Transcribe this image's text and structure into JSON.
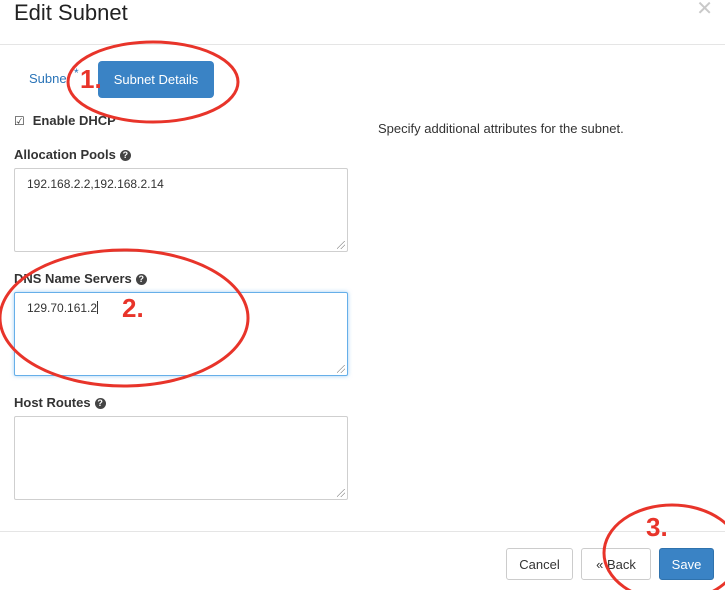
{
  "dialog": {
    "title": "Edit Subnet",
    "close_glyph": "✕"
  },
  "tabs": {
    "subnet_label": "Subne",
    "asterisk": "*",
    "details_label": "Subnet Details"
  },
  "form": {
    "enable_dhcp": {
      "label": "Enable DHCP",
      "checked": true,
      "check_glyph": "☑"
    },
    "help_text": "Specify additional attributes for the subnet.",
    "allocation_pools": {
      "label": "Allocation Pools",
      "value": "192.168.2.2,192.168.2.14"
    },
    "dns_name_servers": {
      "label": "DNS Name Servers",
      "value": "129.70.161.2"
    },
    "host_routes": {
      "label": "Host Routes",
      "value": ""
    },
    "help_glyph": "?"
  },
  "footer": {
    "cancel_label": "Cancel",
    "back_label": "« Back",
    "save_label": "Save"
  },
  "annotations": {
    "step1": "1.",
    "step2": "2.",
    "step3": "3.",
    "color": "#e8342a"
  },
  "colors": {
    "primary": "#3a83c5",
    "link": "#2a74b8"
  }
}
